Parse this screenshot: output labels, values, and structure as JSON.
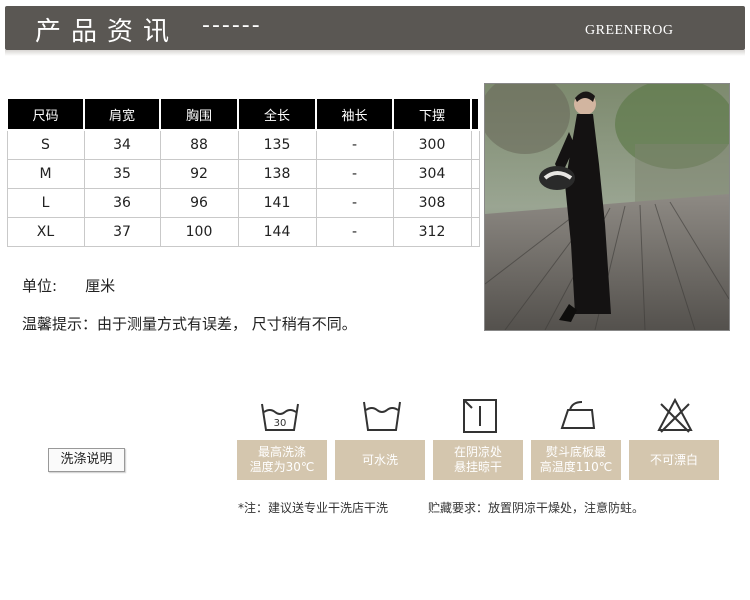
{
  "header": {
    "title": "产品资讯",
    "dashes": "------",
    "brand": "GREENFROG"
  },
  "size_table": {
    "headers": [
      "尺码",
      "肩宽",
      "胸围",
      "全长",
      "袖长",
      "下摆"
    ],
    "rows": [
      [
        "S",
        "34",
        "88",
        "135",
        "-",
        "300"
      ],
      [
        "M",
        "35",
        "92",
        "138",
        "-",
        "304"
      ],
      [
        "L",
        "36",
        "96",
        "141",
        "-",
        "308"
      ],
      [
        "XL",
        "37",
        "100",
        "144",
        "-",
        "312"
      ]
    ]
  },
  "unit": {
    "label": "单位:",
    "value": "厘米"
  },
  "tip": "温馨提示：由于测量方式有误差，  尺寸稍有不同。",
  "wash_button": "洗涤说明",
  "care": [
    {
      "icon": "wash-30-icon",
      "label": "最高洗涤\n温度为30℃",
      "icon_text": "30"
    },
    {
      "icon": "hand-wash-icon",
      "label": "可水洗"
    },
    {
      "icon": "dry-shade-icon",
      "label": "在阴凉处\n悬挂晾干"
    },
    {
      "icon": "iron-icon",
      "label": "熨斗底板最\n高温度110℃"
    },
    {
      "icon": "no-bleach-icon",
      "label": "不可漂白"
    }
  ],
  "notes": {
    "left": "*注：建议送专业干洗店干洗",
    "right": "贮藏要求：放置阴凉干燥处，注意防蛀。"
  },
  "colors": {
    "header_bg": "#5a5753",
    "care_box": "#d4c6ae",
    "table_header": "#000000"
  }
}
